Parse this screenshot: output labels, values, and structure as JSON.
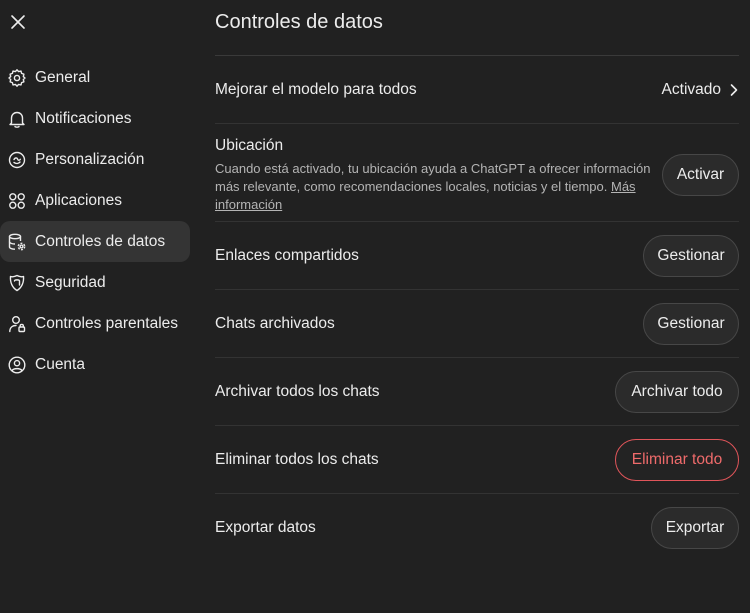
{
  "sidebar": {
    "items": [
      {
        "label": "General",
        "icon": "gear-icon",
        "active": false
      },
      {
        "label": "Notificaciones",
        "icon": "bell-icon",
        "active": false
      },
      {
        "label": "Personalización",
        "icon": "personalization-icon",
        "active": false
      },
      {
        "label": "Aplicaciones",
        "icon": "apps-grid-icon",
        "active": false
      },
      {
        "label": "Controles de datos",
        "icon": "database-gear-icon",
        "active": true
      },
      {
        "label": "Seguridad",
        "icon": "shield-icon",
        "active": false
      },
      {
        "label": "Controles parentales",
        "icon": "parental-user-icon",
        "active": false
      },
      {
        "label": "Cuenta",
        "icon": "user-circle-icon",
        "active": false
      }
    ]
  },
  "main": {
    "title": "Controles de datos",
    "improve_model": {
      "label": "Mejorar el modelo para todos",
      "value": "Activado"
    },
    "location": {
      "title": "Ubicación",
      "description": "Cuando está activado, tu ubicación ayuda a ChatGPT a ofrecer información más relevante, como recomendaciones locales, noticias y el tiempo.",
      "link": "Más información",
      "button": "Activar"
    },
    "shared_links": {
      "label": "Enlaces compartidos",
      "button": "Gestionar"
    },
    "archived_chats": {
      "label": "Chats archivados",
      "button": "Gestionar"
    },
    "archive_all": {
      "label": "Archivar todos los chats",
      "button": "Archivar todo"
    },
    "delete_all": {
      "label": "Eliminar todos los chats",
      "button": "Eliminar todo"
    },
    "export": {
      "label": "Exportar datos",
      "button": "Exportar"
    }
  },
  "colors": {
    "background": "#212121",
    "active_item": "#343434",
    "danger": "#ef6b6b"
  }
}
